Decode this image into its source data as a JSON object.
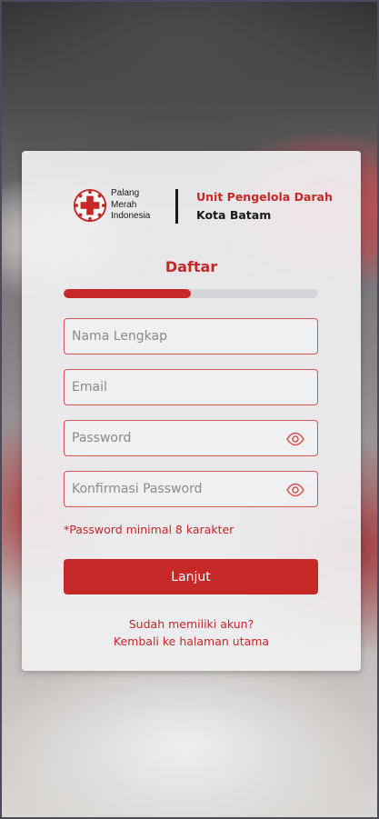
{
  "header": {
    "logo_lines": [
      "Palang",
      "Merah",
      "Indonesia"
    ],
    "unit_title": "Unit Pengelola Darah",
    "unit_city": "Kota Batam"
  },
  "form": {
    "title": "Daftar",
    "progress_fraction": 0.5,
    "fields": {
      "name": {
        "value": "",
        "placeholder": "Nama Lengkap"
      },
      "email": {
        "value": "",
        "placeholder": "Email"
      },
      "password": {
        "value": "",
        "placeholder": "Password"
      },
      "confirm": {
        "value": "",
        "placeholder": "Konfirmasi Password"
      }
    },
    "hint": "*Password minimal 8 karakter",
    "submit_label": "Lanjut"
  },
  "links": {
    "login": "Sudah memiliki akun?",
    "home": "Kembali ke halaman utama"
  },
  "colors": {
    "accent": "#c62828",
    "field_border": "#d9534f",
    "progress_track": "#d6d6da"
  },
  "icons": [
    "red-cross-icon",
    "eye-icon"
  ]
}
